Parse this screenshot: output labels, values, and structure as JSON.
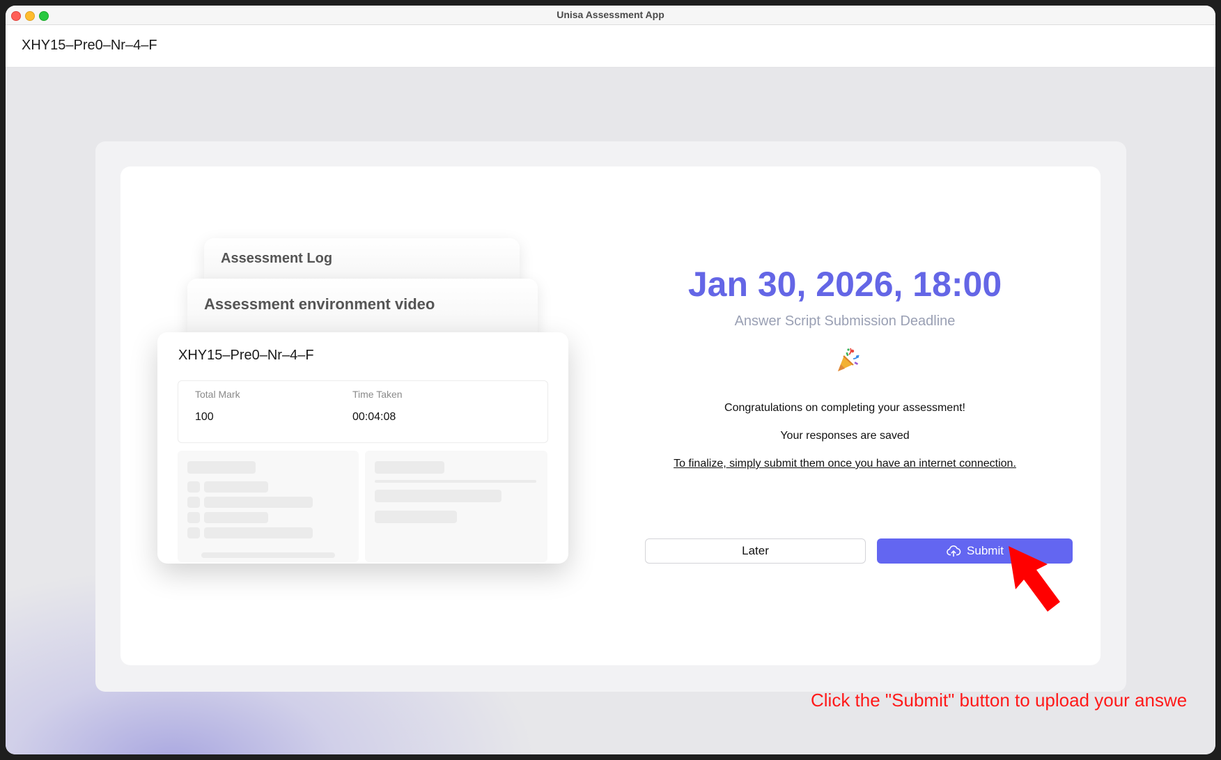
{
  "window": {
    "title": "Unisa Assessment App"
  },
  "header": {
    "assessment_code": "XHY15–Pre0–Nr–4–F"
  },
  "cards": {
    "log_label": "Assessment Log",
    "video_label": "Assessment environment video",
    "main": {
      "assessment_code": "XHY15–Pre0–Nr–4–F",
      "total_mark_label": "Total Mark",
      "total_mark_value": "100",
      "time_taken_label": "Time Taken",
      "time_taken_value": "00:04:08"
    }
  },
  "deadline": {
    "date": "Jan 30, 2026, 18:00",
    "label": "Answer Script Submission Deadline"
  },
  "messages": {
    "congrats": "Congratulations on completing your assessment!",
    "saved": "Your responses are saved",
    "finalize": "To finalize, simply submit them once you have an internet connection."
  },
  "buttons": {
    "later": "Later",
    "submit": "Submit"
  },
  "annotation": {
    "hint": "Click the \"Submit\" button to upload your answe"
  },
  "colors": {
    "accent": "#6366f1",
    "deadline": "#6466e6",
    "hint": "#ff1a1a"
  },
  "icons": {
    "submit": "cloud-upload-icon",
    "celebration": "party-popper-icon",
    "pointer": "red-arrow-icon"
  }
}
